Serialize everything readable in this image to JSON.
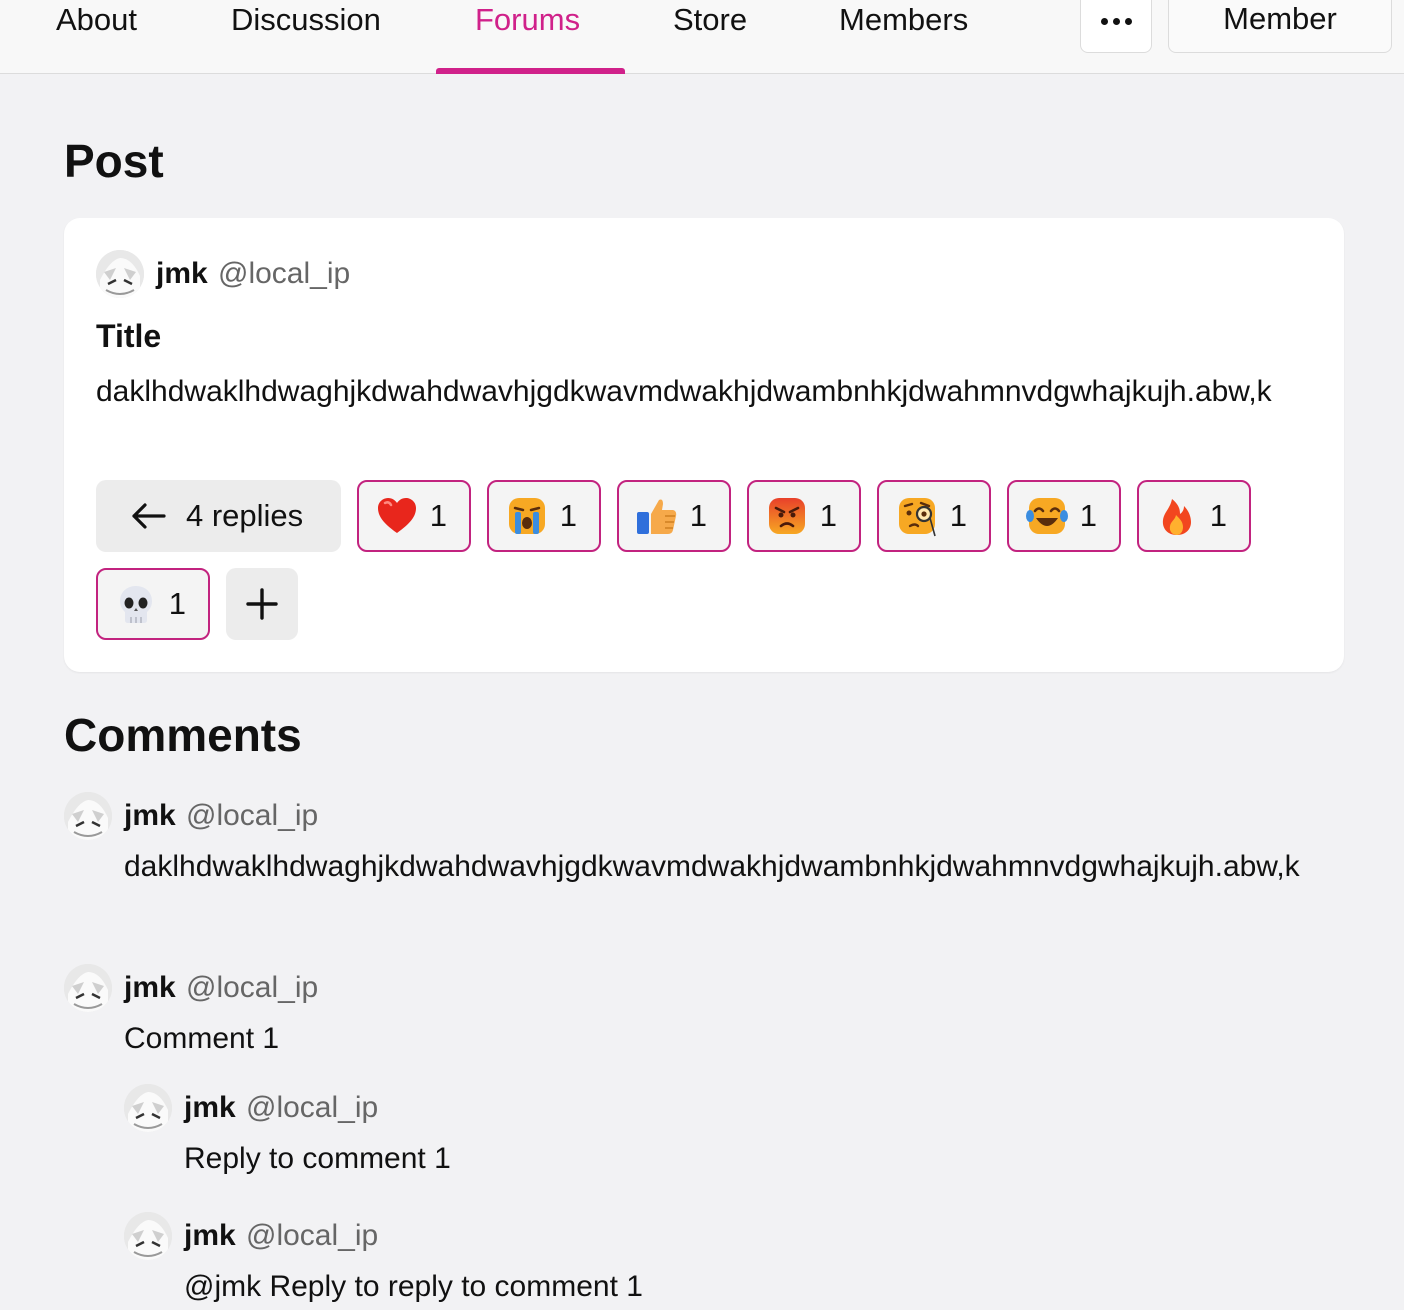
{
  "nav": {
    "tabs": [
      {
        "label": "About"
      },
      {
        "label": "Discussion"
      },
      {
        "label": "Forums",
        "active": true
      },
      {
        "label": "Store"
      },
      {
        "label": "Members"
      }
    ],
    "member_label": "Member",
    "accent_color": "#d0218a"
  },
  "post_section": {
    "heading": "Post",
    "author": {
      "name": "jmk",
      "handle": "@local_ip"
    },
    "title": "Title",
    "body": "daklhdwaklhdwaghjkdwahdwavhjgdkwavmdwakhjdwambnhkjdwahmnvdgwhajkujh.abw,k",
    "replies_label": "4 replies",
    "reactions": [
      {
        "icon": "heart",
        "count": "1"
      },
      {
        "icon": "loudly-crying-face",
        "count": "1"
      },
      {
        "icon": "thumbs-up",
        "count": "1"
      },
      {
        "icon": "angry-face",
        "count": "1"
      },
      {
        "icon": "face-with-monocle",
        "count": "1"
      },
      {
        "icon": "face-with-tears-of-joy",
        "count": "1"
      },
      {
        "icon": "fire",
        "count": "1"
      },
      {
        "icon": "skull",
        "count": "1"
      }
    ]
  },
  "comments_section": {
    "heading": "Comments",
    "comments": [
      {
        "name": "jmk",
        "handle": "@local_ip",
        "text": "daklhdwaklhdwaghjkdwahdwavhjgdkwavmdwakhjdwambnhkjdwahmnvdgwhajkujh.abw,k"
      },
      {
        "name": "jmk",
        "handle": "@local_ip",
        "text": "Comment 1"
      },
      {
        "name": "jmk",
        "handle": "@local_ip",
        "text": "Reply to comment 1"
      },
      {
        "name": "jmk",
        "handle": "@local_ip",
        "text": "@jmk Reply to reply to comment 1"
      }
    ]
  }
}
